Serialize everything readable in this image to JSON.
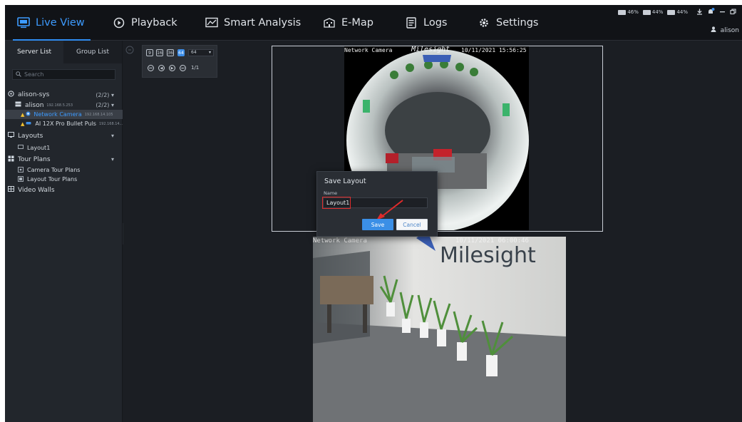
{
  "nav": {
    "items": [
      {
        "label": "Live View",
        "icon": "monitor-icon",
        "active": true
      },
      {
        "label": "Playback",
        "icon": "play-circle-icon",
        "active": false
      },
      {
        "label": "Smart Analysis",
        "icon": "chart-icon",
        "active": false
      },
      {
        "label": "E-Map",
        "icon": "building-icon",
        "active": false
      },
      {
        "label": "Logs",
        "icon": "log-icon",
        "active": false
      },
      {
        "label": "Settings",
        "icon": "gear-icon",
        "active": false
      }
    ],
    "stats": [
      "46%",
      "44%",
      "44%"
    ],
    "user": "alison",
    "accent": "#2f8cf0"
  },
  "sidebar": {
    "tabs": [
      "Server List",
      "Group List"
    ],
    "search_placeholder": "Search",
    "tree": {
      "server": {
        "name": "alison-sys",
        "count": "(2/2)"
      },
      "nvr": {
        "name": "alison",
        "ip": "192.168.5.253",
        "count": "(2/2)"
      },
      "camera1": {
        "name": "Network Camera",
        "ip": "192.168.14.105"
      },
      "camera2": {
        "name": "AI 12X Pro Bullet Puls",
        "ip": "192.168.14..."
      },
      "layouts": "Layouts",
      "layout1": "Layout1",
      "tour_plans": "Tour Plans",
      "camera_tour": "Camera Tour Plans",
      "layout_tour": "Layout Tour Plans",
      "video_walls": "Video Walls"
    }
  },
  "toolbar": {
    "grid_buttons": [
      "9",
      "16",
      "36",
      "64"
    ],
    "active_grid": "64",
    "select_value": "64",
    "page": "1/1"
  },
  "video": {
    "top": {
      "title": "Network Camera",
      "timestamp": "10/11/2021 15:56:25",
      "logo": "Milesight"
    },
    "bottom": {
      "title": "Network Camera",
      "timestamp": "10/11/2021 06:00:46",
      "logo": "Milesight"
    }
  },
  "dialog": {
    "title": "Save Layout",
    "name_label": "Name",
    "name_value": "Layout1",
    "save_label": "Save",
    "cancel_label": "Cancel"
  }
}
